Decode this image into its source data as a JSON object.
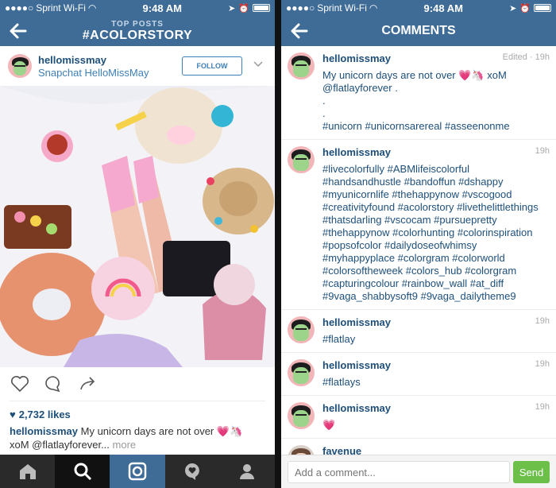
{
  "status": {
    "carrier": "Sprint Wi-Fi",
    "time": "9:48 AM"
  },
  "left": {
    "nav": {
      "subtitle": "TOP POSTS",
      "title": "#ACOLORSTORY"
    },
    "post": {
      "username": "hellomissmay",
      "location": "Snapchat HelloMissMay",
      "follow_label": "FOLLOW",
      "likes": "2,732 likes",
      "caption_user": "hellomissmay",
      "caption_line1": "My unicorn days are not over 💗🦄",
      "caption_line2": "xoM @flatlayforever...",
      "more_label": "more"
    }
  },
  "right": {
    "nav": {
      "title": "COMMENTS"
    },
    "comments": [
      {
        "user": "hellomissmay",
        "time": "Edited · 19h",
        "text": "My unicorn days are not over 💗🦄 xoM\n@flatlayforever .\n.\n.\n#unicorn #unicornsarereal #asseenonme"
      },
      {
        "user": "hellomissmay",
        "time": "19h",
        "text": "#livecolorfully #ABMlifeiscolorful #handsandhustle #bandoffun #dshappy #myunicornlife #thehappynow #vscogood #creativityfound #acolorstory #livethelittlethings #thatsdarling #vscocam #pursuepretty #thehappynow #colorhunting #colorinspiration #popsofcolor #dailydoseofwhimsy #myhappyplace #colorgram #colorworld #colorsoftheweek #colors_hub #colorgram #capturingcolour #rainbow_wall #at_diff #9vaga_shabbysoft9 #9vaga_dailytheme9"
      },
      {
        "user": "hellomissmay",
        "time": "19h",
        "text": "#flatlay"
      },
      {
        "user": "hellomissmay",
        "time": "19h",
        "text": "#flatlays"
      },
      {
        "user": "hellomissmay",
        "time": "19h",
        "text": "💗"
      },
      {
        "user": "favenue__",
        "time": "",
        "text": ""
      }
    ],
    "input_placeholder": "Add a comment...",
    "send_label": "Send"
  },
  "colors": {
    "nav_blue": "#3e6c97",
    "link_blue": "#1d4f7a",
    "send_green": "#6cc04a"
  }
}
